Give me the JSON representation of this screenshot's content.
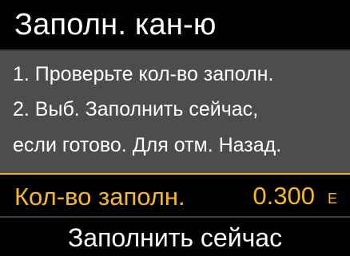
{
  "header": {
    "title": "Заполн. кан-ю"
  },
  "message": {
    "lines": [
      "1. Проверьте кол-во заполн.",
      "2. Выб. Заполнить сейчас,",
      "если готово. Для отм. Назад."
    ]
  },
  "fill_amount": {
    "label": "Кол-во заполн.",
    "value": "0.300",
    "unit": "Е"
  },
  "action": {
    "label": "Заполнить сейчас"
  },
  "colors": {
    "background": "#000000",
    "panel": "#4d4d4d",
    "text": "#ffffff",
    "accent": "#f5b82a"
  }
}
